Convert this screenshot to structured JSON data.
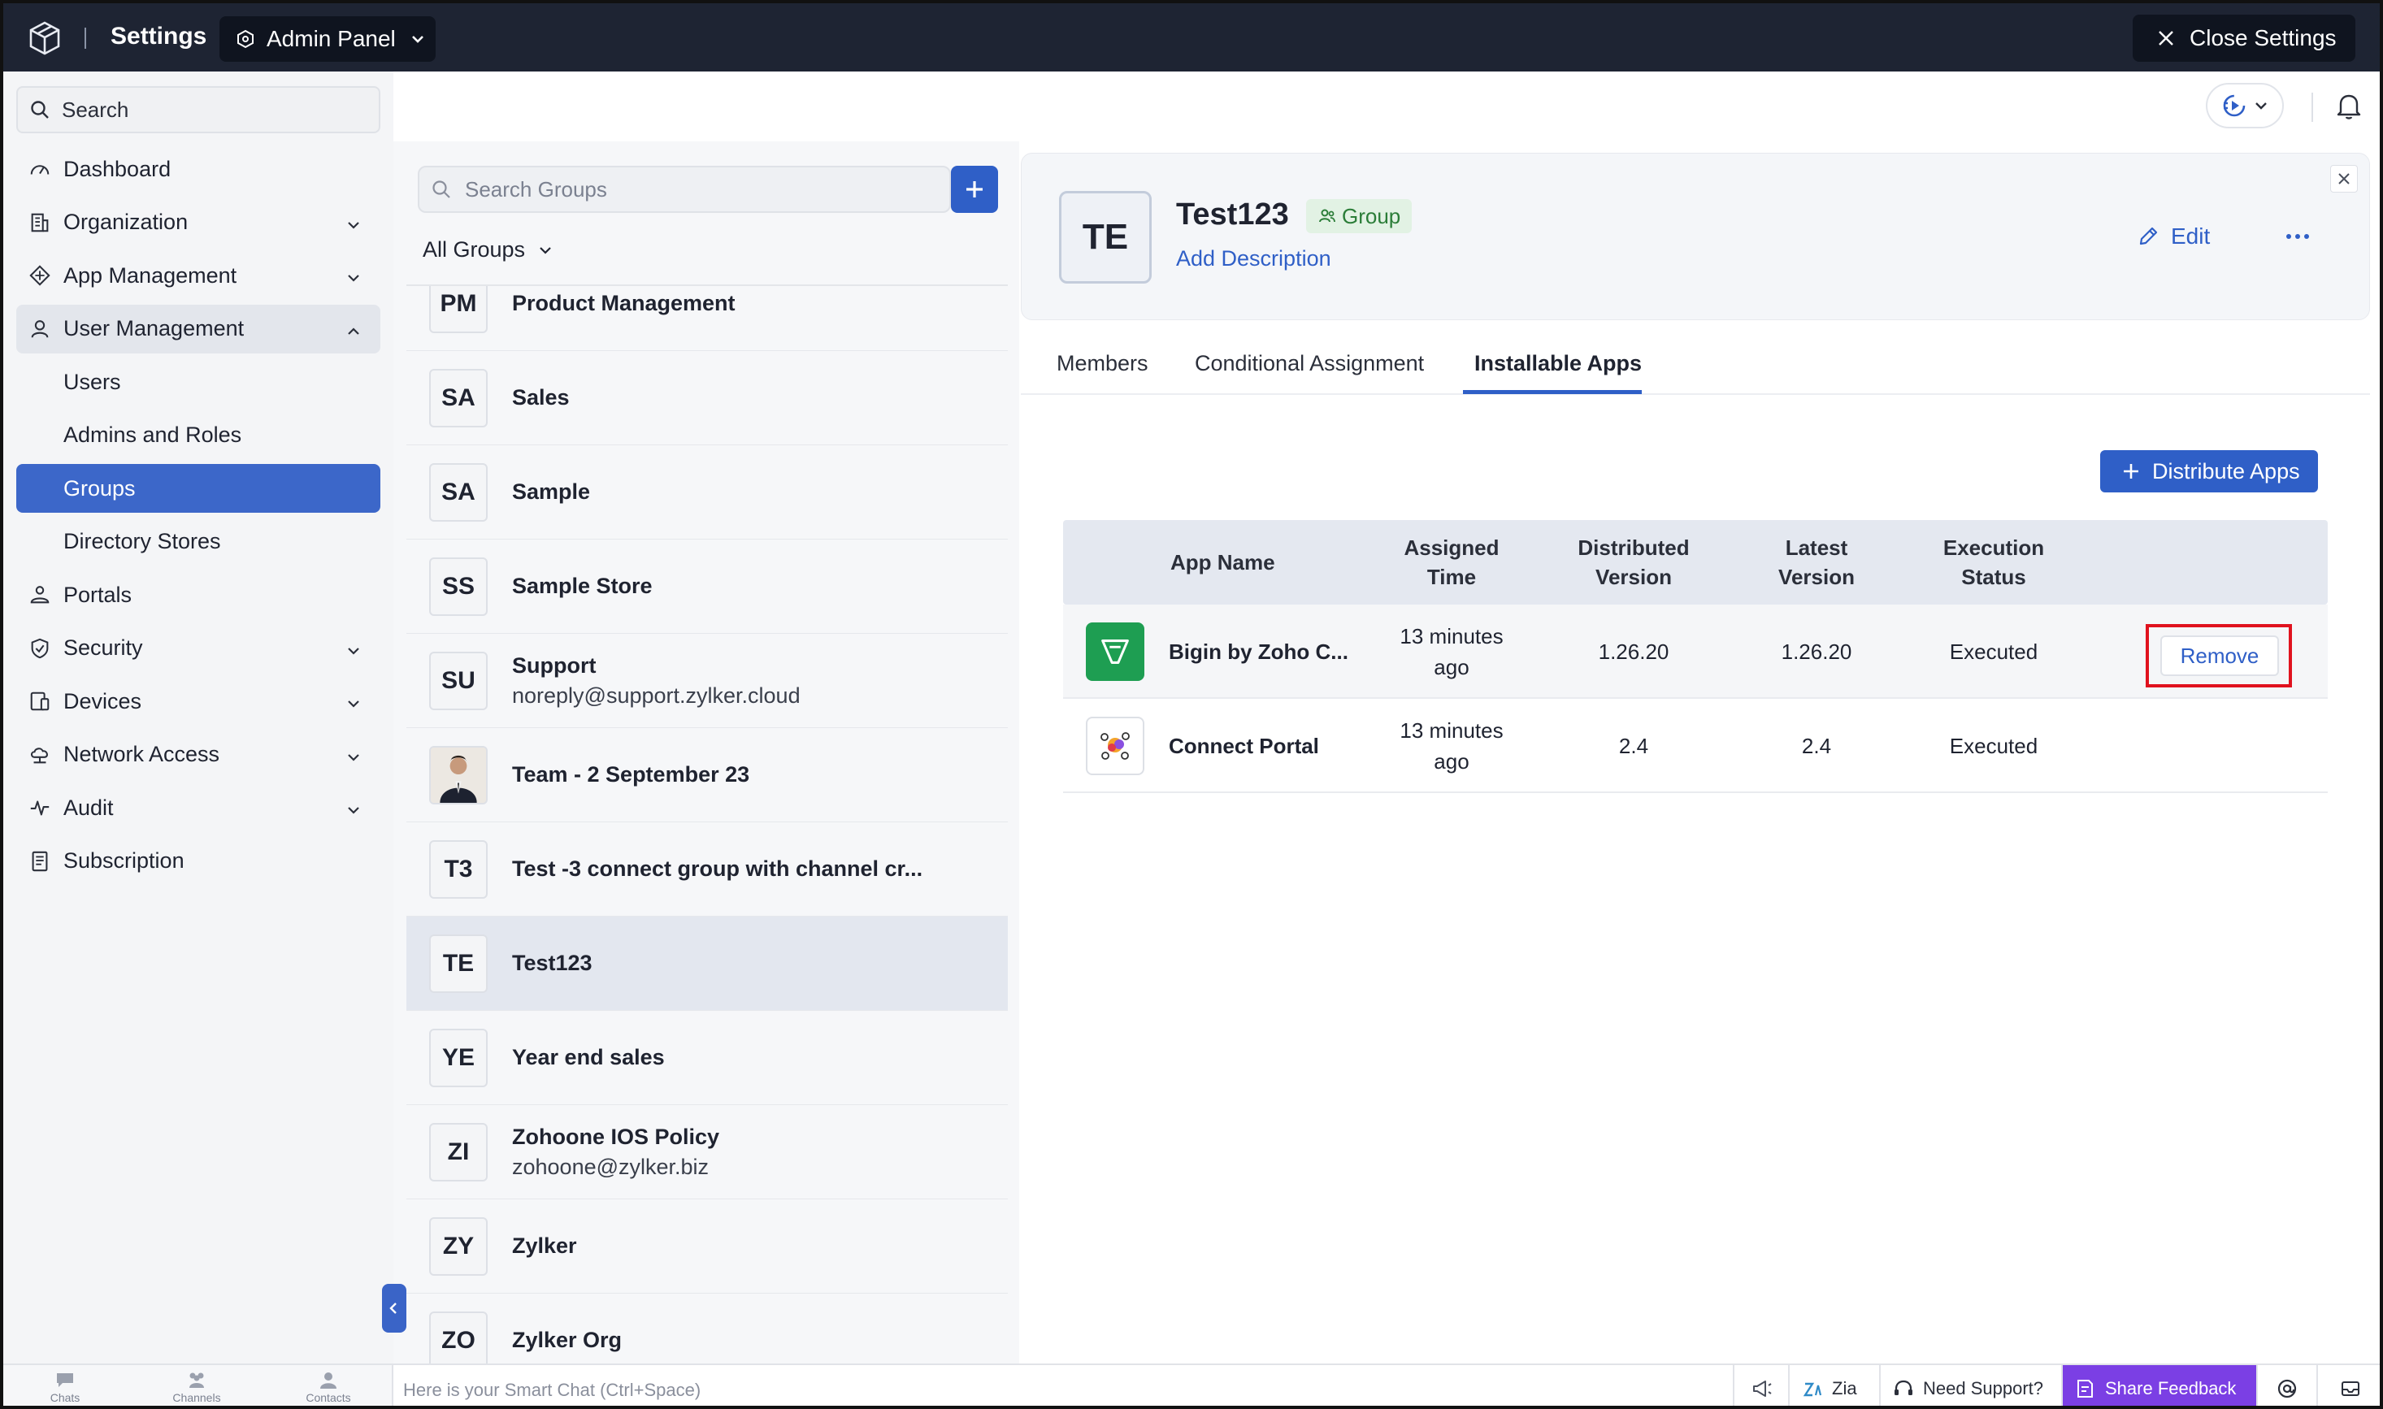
{
  "topbar": {
    "title": "Settings",
    "panel_label": "Admin Panel",
    "close_label": "Close Settings"
  },
  "sidebar": {
    "search_placeholder": "Search",
    "items": [
      {
        "label": "Dashboard",
        "icon": "gauge-icon",
        "chevron": "none",
        "state": "normal"
      },
      {
        "label": "Organization",
        "icon": "building-icon",
        "chevron": "down",
        "state": "normal"
      },
      {
        "label": "App Management",
        "icon": "apps-icon",
        "chevron": "down",
        "state": "normal"
      },
      {
        "label": "User Management",
        "icon": "user-icon",
        "chevron": "up",
        "state": "expanded"
      },
      {
        "label": "Users",
        "icon": "",
        "chevron": "none",
        "state": "sub"
      },
      {
        "label": "Admins and Roles",
        "icon": "",
        "chevron": "none",
        "state": "sub"
      },
      {
        "label": "Groups",
        "icon": "",
        "chevron": "none",
        "state": "sub-active"
      },
      {
        "label": "Directory Stores",
        "icon": "",
        "chevron": "none",
        "state": "sub"
      },
      {
        "label": "Portals",
        "icon": "portal-users-icon",
        "chevron": "none",
        "state": "normal"
      },
      {
        "label": "Security",
        "icon": "shield-icon",
        "chevron": "down",
        "state": "normal"
      },
      {
        "label": "Devices",
        "icon": "devices-icon",
        "chevron": "down",
        "state": "normal"
      },
      {
        "label": "Network Access",
        "icon": "cloud-network-icon",
        "chevron": "down",
        "state": "normal"
      },
      {
        "label": "Audit",
        "icon": "activity-icon",
        "chevron": "down",
        "state": "normal"
      },
      {
        "label": "Subscription",
        "icon": "receipt-icon",
        "chevron": "none",
        "state": "normal"
      }
    ]
  },
  "groups_panel": {
    "search_placeholder": "Search Groups",
    "filter_label": "All Groups",
    "groups": [
      {
        "initials": "PM",
        "name": "Product Management",
        "sub": "",
        "selected": false,
        "photo": false
      },
      {
        "initials": "SA",
        "name": "Sales",
        "sub": "",
        "selected": false,
        "photo": false
      },
      {
        "initials": "SA",
        "name": "Sample",
        "sub": "",
        "selected": false,
        "photo": false
      },
      {
        "initials": "SS",
        "name": "Sample Store",
        "sub": "",
        "selected": false,
        "photo": false
      },
      {
        "initials": "SU",
        "name": "Support",
        "sub": "noreply@support.zylker.cloud",
        "selected": false,
        "photo": false
      },
      {
        "initials": "",
        "name": "Team - 2 September 23",
        "sub": "",
        "selected": false,
        "photo": true
      },
      {
        "initials": "T3",
        "name": "Test -3 connect group with channel cr...",
        "sub": "",
        "selected": false,
        "photo": false
      },
      {
        "initials": "TE",
        "name": "Test123",
        "sub": "",
        "selected": true,
        "photo": false
      },
      {
        "initials": "YE",
        "name": "Year end sales",
        "sub": "",
        "selected": false,
        "photo": false
      },
      {
        "initials": "ZI",
        "name": "Zohoone IOS Policy",
        "sub": "zohoone@zylker.biz",
        "selected": false,
        "photo": false
      },
      {
        "initials": "ZY",
        "name": "Zylker",
        "sub": "",
        "selected": false,
        "photo": false
      },
      {
        "initials": "ZO",
        "name": "Zylker Org",
        "sub": "",
        "selected": false,
        "photo": false
      }
    ]
  },
  "detail": {
    "avatar_initials": "TE",
    "title": "Test123",
    "badge": "Group",
    "add_description": "Add Description",
    "edit_label": "Edit",
    "tabs": [
      "Members",
      "Conditional Assignment",
      "Installable Apps"
    ],
    "active_tab": "Installable Apps",
    "distribute_label": "Distribute Apps",
    "table": {
      "headers": [
        "App Name",
        "Assigned Time",
        "Distributed Version",
        "Latest Version",
        "Execution Status"
      ],
      "rows": [
        {
          "app": "Bigin by Zoho C...",
          "icon": "bigin-icon",
          "assigned": "13 minutes ago",
          "distributed": "1.26.20",
          "latest": "1.26.20",
          "status": "Executed",
          "action": "Remove"
        },
        {
          "app": "Connect Portal",
          "icon": "connect-portal-icon",
          "assigned": "13 minutes ago",
          "distributed": "2.4",
          "latest": "2.4",
          "status": "Executed",
          "action": ""
        }
      ]
    }
  },
  "bottombar": {
    "chats": "Chats",
    "channels": "Channels",
    "contacts": "Contacts",
    "smart_chat": "Here is your Smart Chat (Ctrl+Space)",
    "zia": "Zia",
    "support": "Need Support?",
    "feedback": "Share Feedback"
  },
  "colors": {
    "topbar": "#1e2433",
    "accent": "#2f5fc7",
    "active_nav": "#3c67c9",
    "highlight_box": "#e0121e",
    "feedback": "#7b3fe4"
  }
}
